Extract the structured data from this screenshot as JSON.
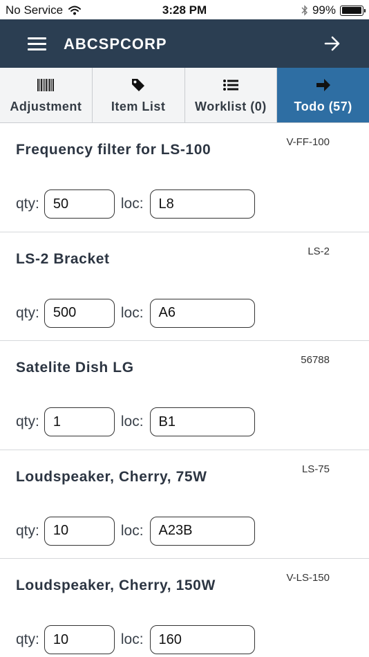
{
  "status_bar": {
    "carrier": "No Service",
    "time": "3:28 PM",
    "battery": "99%",
    "battery_level": 0.99
  },
  "header": {
    "title": "ABCSPCORP",
    "menu_icon": "hamburger-icon",
    "nav_icon": "arrow-right-icon"
  },
  "tabs": [
    {
      "label": "Adjustment",
      "icon": "barcode-icon",
      "active": false
    },
    {
      "label": "Item List",
      "icon": "tag-icon",
      "active": false
    },
    {
      "label": "Worklist (0)",
      "icon": "list-icon",
      "active": false
    },
    {
      "label": "Todo (57)",
      "icon": "arrow-right-icon",
      "active": true
    }
  ],
  "labels": {
    "qty": "qty:",
    "loc": "loc:"
  },
  "items": [
    {
      "name": "Frequency filter for LS-100",
      "code": "V-FF-100",
      "qty": "50",
      "loc": "L8"
    },
    {
      "name": "LS-2 Bracket",
      "code": "LS-2",
      "qty": "500",
      "loc": "A6"
    },
    {
      "name": "Satelite Dish LG",
      "code": "56788",
      "qty": "1",
      "loc": "B1"
    },
    {
      "name": "Loudspeaker, Cherry, 75W",
      "code": "LS-75",
      "qty": "10",
      "loc": "A23B"
    },
    {
      "name": "Loudspeaker, Cherry, 150W",
      "code": "V-LS-150",
      "qty": "10",
      "loc": "160"
    }
  ],
  "colors": {
    "header_bg": "#2b3e52",
    "active_tab_bg": "#2e6ea3",
    "tab_bg": "#f3f4f5"
  }
}
